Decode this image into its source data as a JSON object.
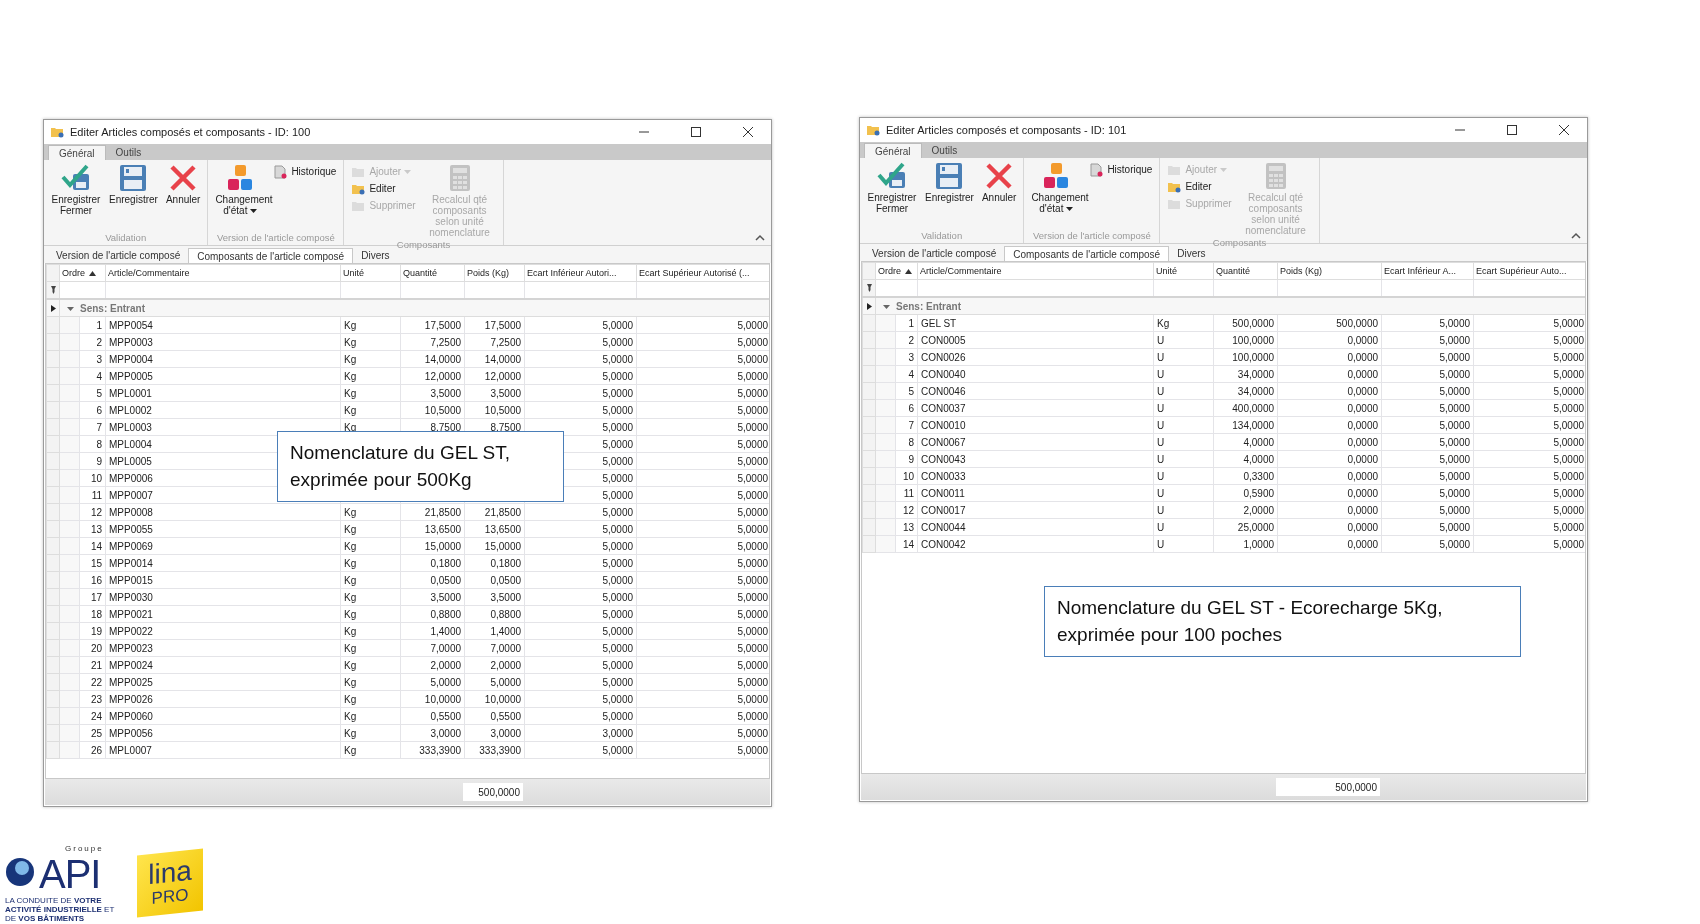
{
  "windows": [
    {
      "title": "Editer Articles composés et composants - ID: 100",
      "ribbon_tabs": [
        {
          "label": "Général",
          "selected": true
        },
        {
          "label": "Outils",
          "selected": false
        }
      ],
      "ribbon_groups": [
        {
          "label": "Validation",
          "buttons": [
            {
              "kind": "large",
              "label": "Enregistrer Fermer",
              "disabled": false,
              "dropdown": false
            },
            {
              "kind": "large",
              "label": "Enregistrer",
              "disabled": false,
              "dropdown": false
            },
            {
              "kind": "large",
              "label": "Annuler",
              "disabled": false,
              "dropdown": false
            }
          ]
        },
        {
          "label": "Version de l'article composé",
          "buttons": [
            {
              "kind": "large",
              "label": "Changement d'état",
              "disabled": false,
              "dropdown": true
            },
            {
              "kind": "small",
              "label": "Historique",
              "disabled": false,
              "dropdown": false
            }
          ]
        },
        {
          "label": "Composants",
          "buttons": [
            {
              "kind": "small",
              "label": "Ajouter",
              "disabled": true,
              "dropdown": true
            },
            {
              "kind": "small",
              "label": "Editer",
              "disabled": false,
              "dropdown": false
            },
            {
              "kind": "small",
              "label": "Supprimer",
              "disabled": true,
              "dropdown": false
            },
            {
              "kind": "large",
              "label": "Recalcul qté composants selon unité nomenclature",
              "disabled": true,
              "dropdown": false
            }
          ]
        }
      ],
      "subtabs": [
        {
          "label": "Version de l'article composé",
          "selected": false
        },
        {
          "label": "Composants de l'article composé",
          "selected": true
        },
        {
          "label": "Divers",
          "selected": false
        }
      ],
      "columns": [
        "Ordre",
        "Article/Commentaire",
        "Unité",
        "Quantité",
        "Poids (Kg)",
        "Ecart Inférieur Autori...",
        "Ecart Supérieur Autorisé (..."
      ],
      "group": "Sens: Entrant",
      "rows": [
        {
          "order": "1",
          "article": "MPP0054",
          "unit": "Kg",
          "quantity": "17,5000",
          "weight": "17,5000",
          "ecart_inf": "5,0000",
          "ecart_sup": "5,0000"
        },
        {
          "order": "2",
          "article": "MPP0003",
          "unit": "Kg",
          "quantity": "7,2500",
          "weight": "7,2500",
          "ecart_inf": "5,0000",
          "ecart_sup": "5,0000"
        },
        {
          "order": "3",
          "article": "MPP0004",
          "unit": "Kg",
          "quantity": "14,0000",
          "weight": "14,0000",
          "ecart_inf": "5,0000",
          "ecart_sup": "5,0000"
        },
        {
          "order": "4",
          "article": "MPP0005",
          "unit": "Kg",
          "quantity": "12,0000",
          "weight": "12,0000",
          "ecart_inf": "5,0000",
          "ecart_sup": "5,0000"
        },
        {
          "order": "5",
          "article": "MPL0001",
          "unit": "Kg",
          "quantity": "3,5000",
          "weight": "3,5000",
          "ecart_inf": "5,0000",
          "ecart_sup": "5,0000"
        },
        {
          "order": "6",
          "article": "MPL0002",
          "unit": "Kg",
          "quantity": "10,5000",
          "weight": "10,5000",
          "ecart_inf": "5,0000",
          "ecart_sup": "5,0000"
        },
        {
          "order": "7",
          "article": "MPL0003",
          "unit": "Kg",
          "quantity": "8,7500",
          "weight": "8,7500",
          "ecart_inf": "5,0000",
          "ecart_sup": "5,0000"
        },
        {
          "order": "8",
          "article": "MPL0004",
          "ecart_inf": "5,0000",
          "ecart_sup": "5,0000"
        },
        {
          "order": "9",
          "article": "MPL0005",
          "ecart_inf": "5,0000",
          "ecart_sup": "5,0000"
        },
        {
          "order": "10",
          "article": "MPP0006",
          "ecart_inf": "5,0000",
          "ecart_sup": "5,0000"
        },
        {
          "order": "11",
          "article": "MPP0007",
          "ecart_inf": "5,0000",
          "ecart_sup": "5,0000"
        },
        {
          "order": "12",
          "article": "MPP0008",
          "unit": "Kg",
          "quantity": "21,8500",
          "weight": "21,8500",
          "ecart_inf": "5,0000",
          "ecart_sup": "5,0000"
        },
        {
          "order": "13",
          "article": "MPP0055",
          "unit": "Kg",
          "quantity": "13,6500",
          "weight": "13,6500",
          "ecart_inf": "5,0000",
          "ecart_sup": "5,0000"
        },
        {
          "order": "14",
          "article": "MPP0069",
          "unit": "Kg",
          "quantity": "15,0000",
          "weight": "15,0000",
          "ecart_inf": "5,0000",
          "ecart_sup": "5,0000"
        },
        {
          "order": "15",
          "article": "MPP0014",
          "unit": "Kg",
          "quantity": "0,1800",
          "weight": "0,1800",
          "ecart_inf": "5,0000",
          "ecart_sup": "5,0000"
        },
        {
          "order": "16",
          "article": "MPP0015",
          "unit": "Kg",
          "quantity": "0,0500",
          "weight": "0,0500",
          "ecart_inf": "5,0000",
          "ecart_sup": "5,0000"
        },
        {
          "order": "17",
          "article": "MPP0030",
          "unit": "Kg",
          "quantity": "3,5000",
          "weight": "3,5000",
          "ecart_inf": "5,0000",
          "ecart_sup": "5,0000"
        },
        {
          "order": "18",
          "article": "MPP0021",
          "unit": "Kg",
          "quantity": "0,8800",
          "weight": "0,8800",
          "ecart_inf": "5,0000",
          "ecart_sup": "5,0000"
        },
        {
          "order": "19",
          "article": "MPP0022",
          "unit": "Kg",
          "quantity": "1,4000",
          "weight": "1,4000",
          "ecart_inf": "5,0000",
          "ecart_sup": "5,0000"
        },
        {
          "order": "20",
          "article": "MPP0023",
          "unit": "Kg",
          "quantity": "7,0000",
          "weight": "7,0000",
          "ecart_inf": "5,0000",
          "ecart_sup": "5,0000"
        },
        {
          "order": "21",
          "article": "MPP0024",
          "unit": "Kg",
          "quantity": "2,0000",
          "weight": "2,0000",
          "ecart_inf": "5,0000",
          "ecart_sup": "5,0000"
        },
        {
          "order": "22",
          "article": "MPP0025",
          "unit": "Kg",
          "quantity": "5,0000",
          "weight": "5,0000",
          "ecart_inf": "5,0000",
          "ecart_sup": "5,0000"
        },
        {
          "order": "23",
          "article": "MPP0026",
          "unit": "Kg",
          "quantity": "10,0000",
          "weight": "10,0000",
          "ecart_inf": "5,0000",
          "ecart_sup": "5,0000"
        },
        {
          "order": "24",
          "article": "MPP0060",
          "unit": "Kg",
          "quantity": "0,5500",
          "weight": "0,5500",
          "ecart_inf": "5,0000",
          "ecart_sup": "5,0000"
        },
        {
          "order": "25",
          "article": "MPP0056",
          "unit": "Kg",
          "quantity": "3,0000",
          "weight": "3,0000",
          "ecart_inf": "3,0000",
          "ecart_sup": "5,0000"
        },
        {
          "order": "26",
          "article": "MPL0007",
          "unit": "Kg",
          "quantity": "333,3900",
          "weight": "333,3900",
          "ecart_inf": "5,0000",
          "ecart_sup": "5,0000"
        }
      ],
      "total": "500,0000"
    },
    {
      "title": "Editer Articles composés et composants - ID: 101",
      "ribbon_tabs": [
        {
          "label": "Général",
          "selected": true
        },
        {
          "label": "Outils",
          "selected": false
        }
      ],
      "ribbon_groups": [
        {
          "label": "Validation",
          "buttons": [
            {
              "kind": "large",
              "label": "Enregistrer Fermer",
              "disabled": false,
              "dropdown": false
            },
            {
              "kind": "large",
              "label": "Enregistrer",
              "disabled": false,
              "dropdown": false
            },
            {
              "kind": "large",
              "label": "Annuler",
              "disabled": false,
              "dropdown": false
            }
          ]
        },
        {
          "label": "Version de l'article composé",
          "buttons": [
            {
              "kind": "large",
              "label": "Changement d'état",
              "disabled": false,
              "dropdown": true
            },
            {
              "kind": "small",
              "label": "Historique",
              "disabled": false,
              "dropdown": false
            }
          ]
        },
        {
          "label": "Composants",
          "buttons": [
            {
              "kind": "small",
              "label": "Ajouter",
              "disabled": true,
              "dropdown": true
            },
            {
              "kind": "small",
              "label": "Editer",
              "disabled": false,
              "dropdown": false
            },
            {
              "kind": "small",
              "label": "Supprimer",
              "disabled": true,
              "dropdown": false
            },
            {
              "kind": "large",
              "label": "Recalcul qté composants selon unité nomenclature",
              "disabled": true,
              "dropdown": false
            }
          ]
        }
      ],
      "subtabs": [
        {
          "label": "Version de l'article composé",
          "selected": false
        },
        {
          "label": "Composants de l'article composé",
          "selected": true
        },
        {
          "label": "Divers",
          "selected": false
        }
      ],
      "columns": [
        "Ordre",
        "Article/Commentaire",
        "Unité",
        "Quantité",
        "Poids (Kg)",
        "Ecart Inférieur A...",
        "Ecart Supérieur Auto..."
      ],
      "group": "Sens: Entrant",
      "rows": [
        {
          "order": "1",
          "article": "GEL ST",
          "unit": "Kg",
          "quantity": "500,0000",
          "weight": "500,0000",
          "ecart_inf": "5,0000",
          "ecart_sup": "5,0000"
        },
        {
          "order": "2",
          "article": "CON0005",
          "unit": "U",
          "quantity": "100,0000",
          "weight": "0,0000",
          "ecart_inf": "5,0000",
          "ecart_sup": "5,0000"
        },
        {
          "order": "3",
          "article": "CON0026",
          "unit": "U",
          "quantity": "100,0000",
          "weight": "0,0000",
          "ecart_inf": "5,0000",
          "ecart_sup": "5,0000"
        },
        {
          "order": "4",
          "article": "CON0040",
          "unit": "U",
          "quantity": "34,0000",
          "weight": "0,0000",
          "ecart_inf": "5,0000",
          "ecart_sup": "5,0000"
        },
        {
          "order": "5",
          "article": "CON0046",
          "unit": "U",
          "quantity": "34,0000",
          "weight": "0,0000",
          "ecart_inf": "5,0000",
          "ecart_sup": "5,0000"
        },
        {
          "order": "6",
          "article": "CON0037",
          "unit": "U",
          "quantity": "400,0000",
          "weight": "0,0000",
          "ecart_inf": "5,0000",
          "ecart_sup": "5,0000"
        },
        {
          "order": "7",
          "article": "CON0010",
          "unit": "U",
          "quantity": "134,0000",
          "weight": "0,0000",
          "ecart_inf": "5,0000",
          "ecart_sup": "5,0000"
        },
        {
          "order": "8",
          "article": "CON0067",
          "unit": "U",
          "quantity": "4,0000",
          "weight": "0,0000",
          "ecart_inf": "5,0000",
          "ecart_sup": "5,0000"
        },
        {
          "order": "9",
          "article": "CON0043",
          "unit": "U",
          "quantity": "4,0000",
          "weight": "0,0000",
          "ecart_inf": "5,0000",
          "ecart_sup": "5,0000"
        },
        {
          "order": "10",
          "article": "CON0033",
          "unit": "U",
          "quantity": "0,3300",
          "weight": "0,0000",
          "ecart_inf": "5,0000",
          "ecart_sup": "5,0000"
        },
        {
          "order": "11",
          "article": "CON0011",
          "unit": "U",
          "quantity": "0,5900",
          "weight": "0,0000",
          "ecart_inf": "5,0000",
          "ecart_sup": "5,0000"
        },
        {
          "order": "12",
          "article": "CON0017",
          "unit": "U",
          "quantity": "2,0000",
          "weight": "0,0000",
          "ecart_inf": "5,0000",
          "ecart_sup": "5,0000"
        },
        {
          "order": "13",
          "article": "CON0044",
          "unit": "U",
          "quantity": "25,0000",
          "weight": "0,0000",
          "ecart_inf": "5,0000",
          "ecart_sup": "5,0000"
        },
        {
          "order": "14",
          "article": "CON0042",
          "unit": "U",
          "quantity": "1,0000",
          "weight": "0,0000",
          "ecart_inf": "5,0000",
          "ecart_sup": "5,0000"
        }
      ],
      "total": "500,0000"
    }
  ],
  "callouts": [
    "Nomenclature du GEL ST, exprimée pour 500Kg",
    "Nomenclature du GEL ST - Ecorecharge 5Kg, exprimée pour 100 poches"
  ],
  "logo": {
    "group_word": "Groupe",
    "brand": "API",
    "tagline": "LA CONDUITE DE **VOTRE ACTIVITÉ INDUSTRIELLE** ET DE **VOS BÂTIMENTS**",
    "product": "lina",
    "product_tier": "PRO"
  }
}
